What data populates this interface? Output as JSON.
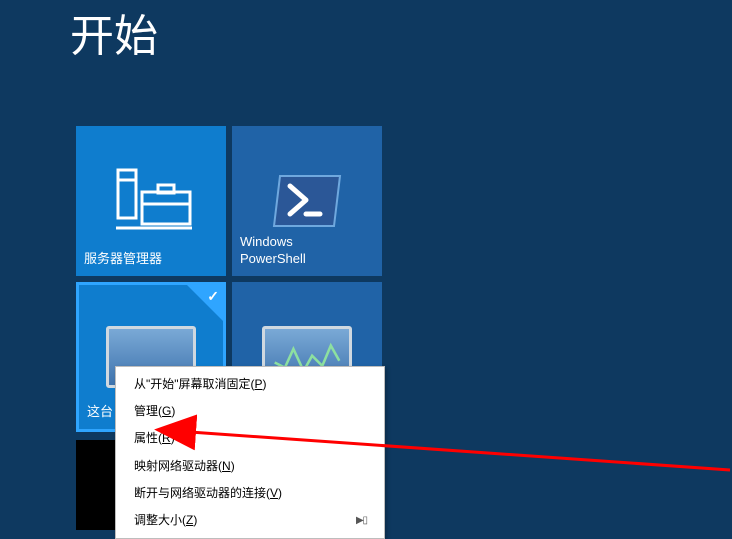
{
  "header": {
    "title": "开始"
  },
  "tiles": {
    "server_manager": {
      "label": "服务器管理器"
    },
    "powershell": {
      "label": "Windows\nPowerShell"
    },
    "this_pc": {
      "label": "这台"
    }
  },
  "context_menu": {
    "items": [
      {
        "text": "从\"开始\"屏幕取消固定",
        "accel": "P"
      },
      {
        "text": "管理",
        "accel": "G"
      },
      {
        "text": "属性",
        "accel": "R"
      },
      {
        "text": "映射网络驱动器",
        "accel": "N"
      },
      {
        "text": "断开与网络驱动器的连接",
        "accel": "V"
      },
      {
        "text": "调整大小",
        "accel": "Z"
      }
    ]
  }
}
